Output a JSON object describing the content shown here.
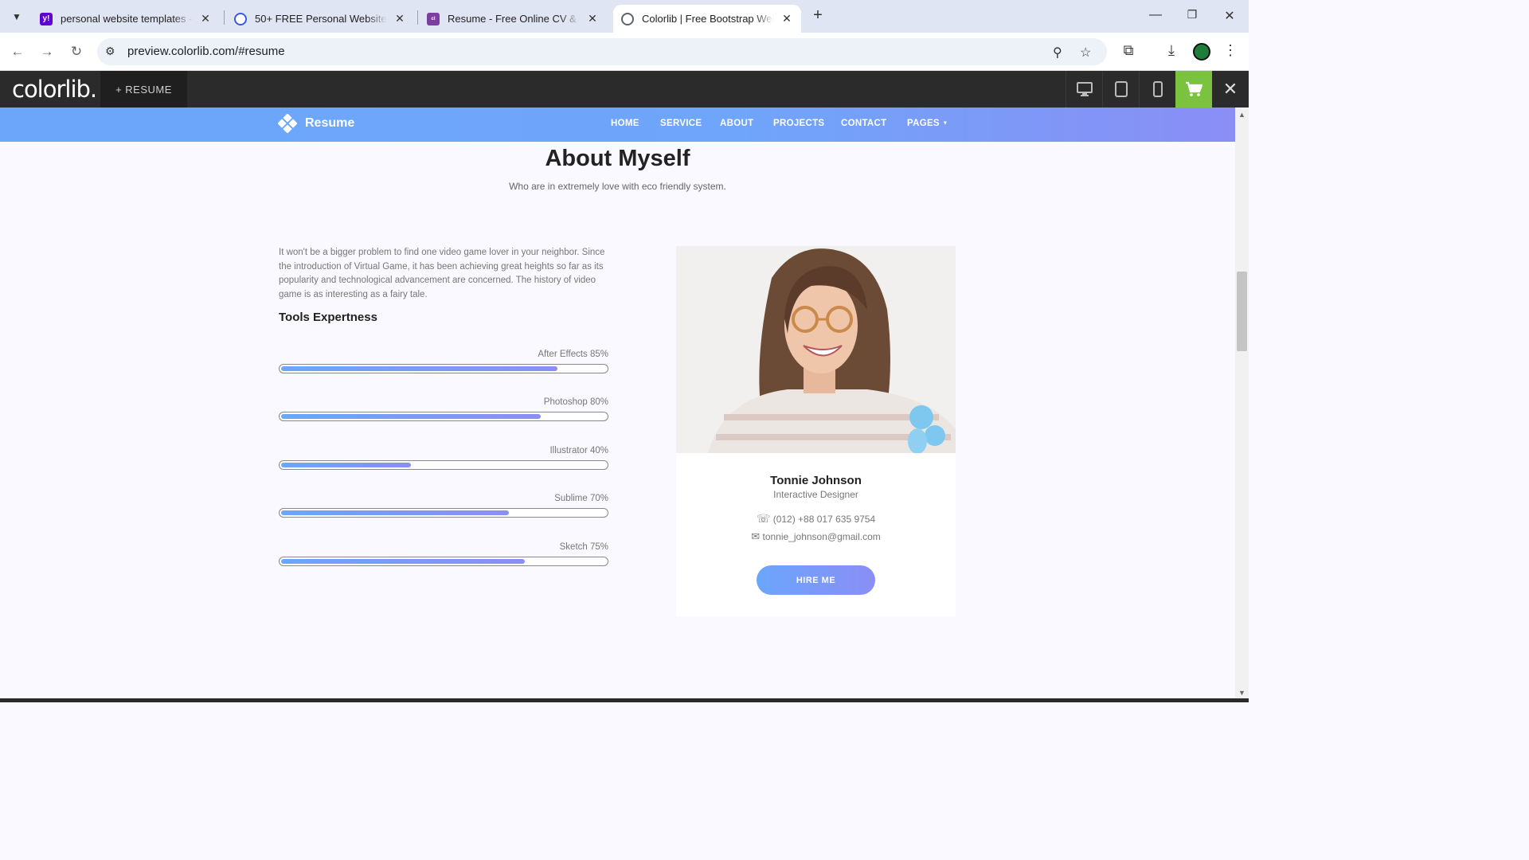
{
  "browser": {
    "tabs": [
      {
        "title": "personal website templates - Ya",
        "favicon": "yahoo-icon",
        "color": "#5f01d1",
        "active": false
      },
      {
        "title": "50+ FREE Personal Website Tem",
        "favicon": "site-icon",
        "color": "#3b5bdb",
        "active": false
      },
      {
        "title": "Resume - Free Online CV & Res",
        "favicon": "colorlib-icon",
        "color": "#7b3fa0",
        "active": false
      },
      {
        "title": "Colorlib | Free Bootstrap Websit",
        "favicon": "globe-icon",
        "color": "#5f6368",
        "active": true
      }
    ],
    "url": "preview.colorlib.com/#resume"
  },
  "colorlib_bar": {
    "logo": "colorlib.",
    "resume_label": "+ RESUME"
  },
  "site": {
    "brand": "Resume",
    "nav": [
      "HOME",
      "SERVICE",
      "ABOUT",
      "PROJECTS",
      "CONTACT",
      "PAGES"
    ],
    "accent_start": "#6ba6fb",
    "accent_end": "#8a8ef5"
  },
  "about": {
    "title": "About Myself",
    "subtitle": "Who are in extremely love with eco friendly system.",
    "intro": "It won't be a bigger problem to find one video game lover in your neighbor. Since the introduction of Virtual Game, it has been achieving great heights so far as its popularity and technological advancement are concerned. The history of video game is as interesting as a fairy tale.",
    "tools_title": "Tools Expertness",
    "skills": [
      {
        "label": "After Effects 85%",
        "value": 85
      },
      {
        "label": "Photoshop 80%",
        "value": 80
      },
      {
        "label": "Illustrator 40%",
        "value": 40
      },
      {
        "label": "Sublime 70%",
        "value": 70
      },
      {
        "label": "Sketch 75%",
        "value": 75
      }
    ]
  },
  "profile": {
    "name": "Tonnie Johnson",
    "role": "Interactive Designer",
    "phone": "(012) +88 017 635 9754",
    "email": "tonnie_johnson@gmail.com",
    "hire_label": "HIRE ME"
  }
}
